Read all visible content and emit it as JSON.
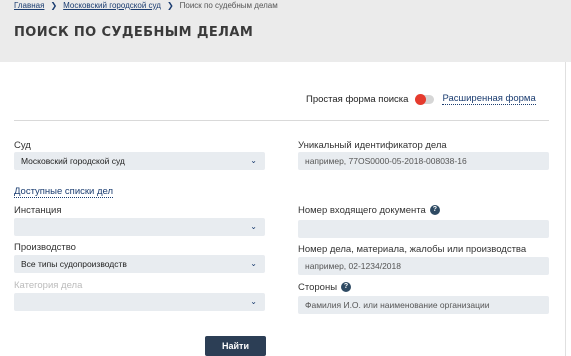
{
  "breadcrumb": {
    "home": "Главная",
    "court": "Московский городской суд",
    "current": "Поиск по судебным делам"
  },
  "page": {
    "title": "ПОИСК ПО СУДЕБНЫМ ДЕЛАМ"
  },
  "mode": {
    "simple_label": "Простая форма поиска",
    "advanced_label": "Расширенная форма",
    "toggle_state": "simple",
    "toggle_color": "#e53b2e"
  },
  "left": {
    "court_label": "Суд",
    "court_value": "Московский городской суд",
    "lists_link": "Доступные списки дел",
    "instance_label": "Инстанция",
    "instance_value": "",
    "proceeding_label": "Производство",
    "proceeding_value": "Все типы судопроизводств",
    "category_label": "Категория дела",
    "category_value": ""
  },
  "right": {
    "uid_label": "Уникальный идентификатор дела",
    "uid_placeholder": "например, 77OS0000-05-2018-008038-16",
    "incoming_label": "Номер входящего документа",
    "incoming_placeholder": "",
    "case_number_label": "Номер дела, материала, жалобы или производства",
    "case_number_placeholder": "например, 02-1234/2018",
    "parties_label": "Стороны",
    "parties_placeholder": "Фамилия И.О. или наименование организации"
  },
  "actions": {
    "search_label": "Найти"
  },
  "icons": {
    "help": "?",
    "chevron": "⌄",
    "separator": "❯"
  },
  "colors": {
    "header_bg": "#ebebeb",
    "accent": "#1a3c70",
    "button_bg": "#2c3e55"
  }
}
